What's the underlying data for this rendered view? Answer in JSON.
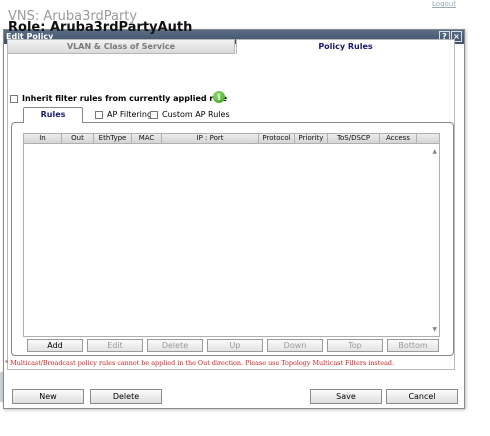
{
  "background": {
    "page_title": "VNS: Aruba3rdParty",
    "logout_label": "Logout"
  },
  "dialog": {
    "title": "Edit Policy",
    "help_label": "?",
    "close_label": "×",
    "role_title": "Role: Aruba3rdPartyAuth",
    "tabs": [
      {
        "label": "VLAN & Class of Service",
        "active": false
      },
      {
        "label": "Policy Rules",
        "active": true
      }
    ],
    "inherit_label": "Inherit filter rules from currently applied role",
    "info_icon": "i",
    "subtabs": {
      "rules_label": "Rules",
      "ap_filtering_label": "AP Filtering",
      "custom_ap_rules_label": "Custom AP Rules"
    },
    "grid": {
      "columns": [
        "In",
        "Out",
        "EthType",
        "MAC",
        "IP : Port",
        "Protocol",
        "Priority",
        "ToS/DSCP",
        "Access"
      ],
      "rows": []
    },
    "grid_buttons": {
      "add": "Add",
      "edit": "Edit",
      "delete": "Delete",
      "up": "Up",
      "down": "Down",
      "top": "Top",
      "bottom": "Bottom"
    },
    "note": "* Multicast/Broadcast policy rules cannot be applied in the Out direction. Please use Topology Multicast Filters instead.",
    "footer": {
      "new": "New",
      "delete": "Delete",
      "save": "Save",
      "cancel": "Cancel"
    }
  },
  "colors": {
    "titlebar": "#4a5b73",
    "active_tab_text": "#1a1a6e",
    "note_text": "#cc2222",
    "info_icon": "#4caf2a"
  }
}
